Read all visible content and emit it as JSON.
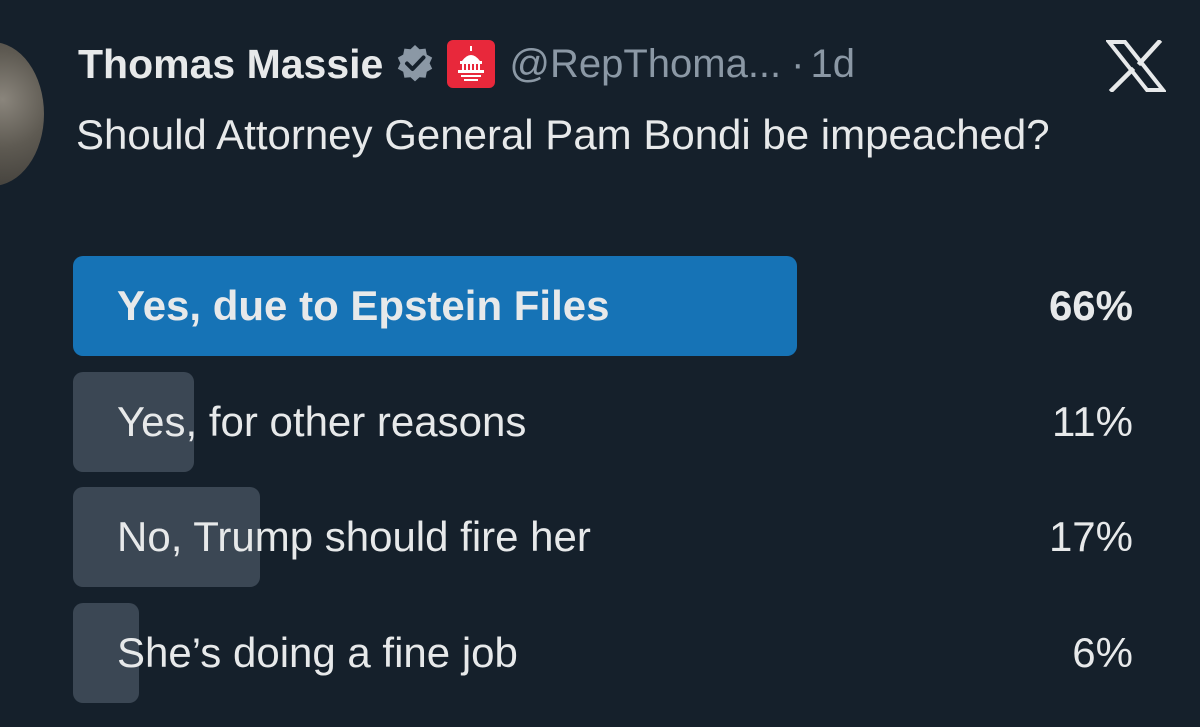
{
  "tweet": {
    "author_name": "Thomas Massie",
    "handle": "@RepThoma...",
    "separator": "·",
    "time": "1d",
    "verified_icon": "verified-badge-icon",
    "affiliation_icon": "house-gop-capitol-icon",
    "text": "Should Attorney General Pam Bondi be impeached?"
  },
  "poll": {
    "options": [
      {
        "label": "Yes, due to Epstein Files",
        "percent_text": "66%",
        "percent": 66,
        "winner": true
      },
      {
        "label": "Yes, for other reasons",
        "percent_text": "11%",
        "percent": 11,
        "winner": false
      },
      {
        "label": "No, Trump should fire her",
        "percent_text": "17%",
        "percent": 17,
        "winner": false
      },
      {
        "label": "She’s doing a fine job",
        "percent_text": "6%",
        "percent": 6,
        "winner": false
      }
    ]
  },
  "colors": {
    "background": "#15202b",
    "winner_bar": "#1673b6",
    "other_bar": "#3b4754",
    "verified": "#8b98a5",
    "affiliation_badge": "#e8283b",
    "secondary_text": "#8b98a5"
  },
  "icons": {
    "close_logo": "x-logo-icon"
  }
}
